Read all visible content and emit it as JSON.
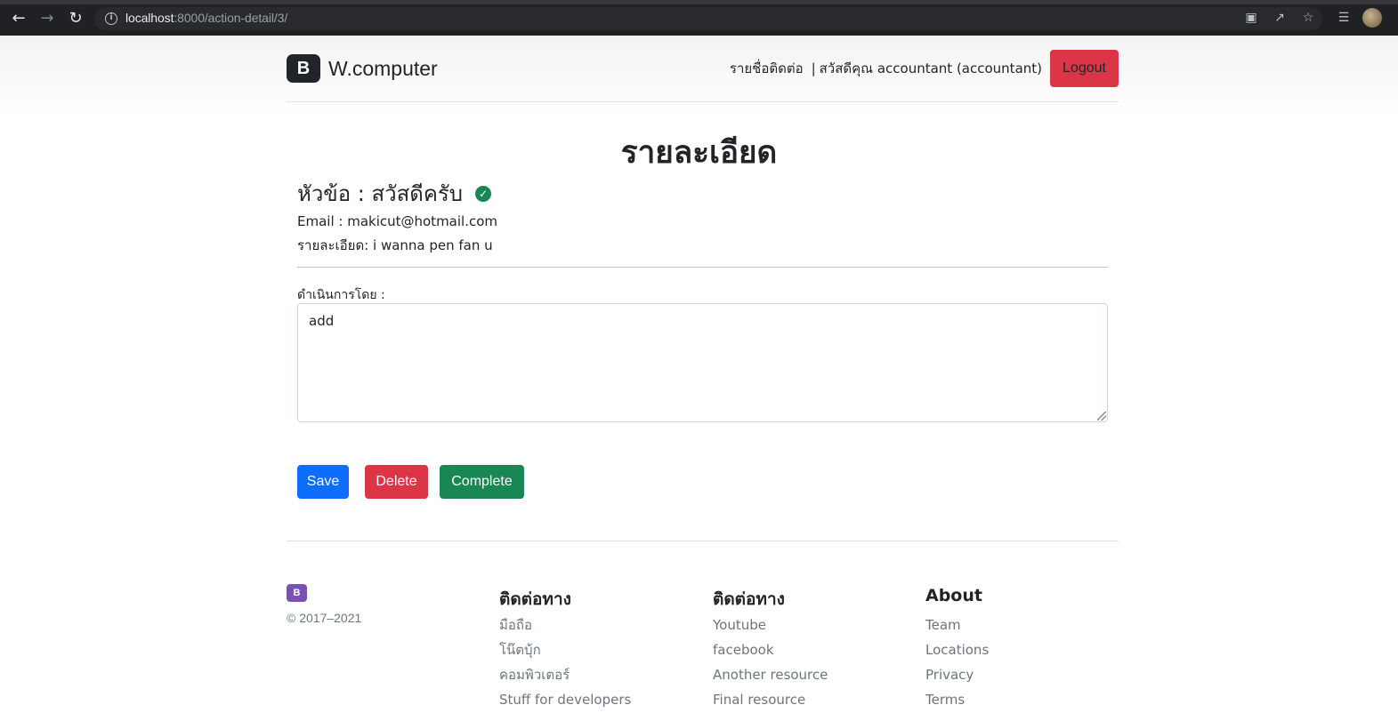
{
  "browser": {
    "url_host": "localhost",
    "url_path": ":8000/action-detail/3/"
  },
  "header": {
    "brand_logo": "B",
    "brand_name": "W.computer",
    "nav_contacts": "รายชื่อติดต่อ",
    "separator": "|",
    "greeting": "สวัสดีคุณ accountant (accountant)",
    "logout_label": "Logout"
  },
  "main": {
    "title": "รายละเอียด",
    "subject": "หัวข้อ : สวัสดีครับ",
    "email_line": "Email : makicut@hotmail.com",
    "detail_line": "รายละเอียด: i wanna pen fan u",
    "action_label": "ดำเนินการโดย :",
    "action_value": "add",
    "save_label": "Save",
    "delete_label": "Delete",
    "complete_label": "Complete"
  },
  "footer": {
    "logo": "B",
    "copyright": "© 2017–2021",
    "columns": [
      {
        "heading": "ติดต่อทาง",
        "links": [
          "มือถือ",
          "โน๊ตบุ้ก",
          "คอมพิวเตอร์",
          "Stuff for developers"
        ]
      },
      {
        "heading": "ติดต่อทาง",
        "links": [
          "Youtube",
          "facebook",
          "Another resource",
          "Final resource"
        ]
      },
      {
        "heading": "About",
        "links": [
          "Team",
          "Locations",
          "Privacy",
          "Terms"
        ]
      }
    ]
  },
  "colors": {
    "primary": "#0d6efd",
    "danger": "#dc3545",
    "success": "#198754",
    "muted": "#6c757d",
    "brand_footer": "#7952b3"
  }
}
